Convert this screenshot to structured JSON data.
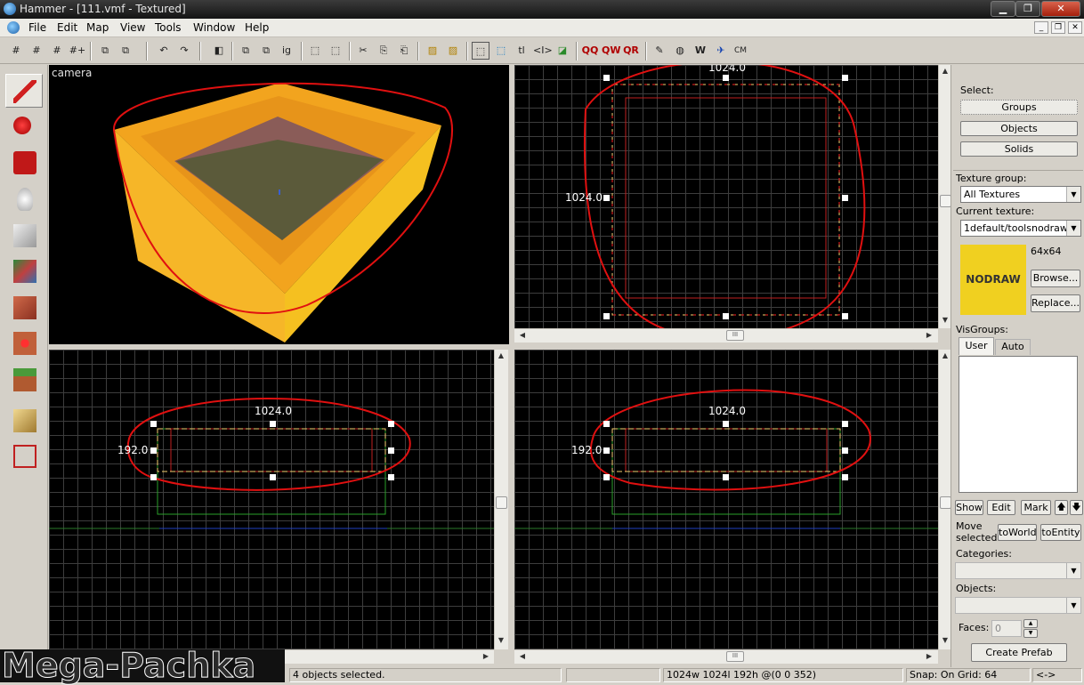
{
  "window": {
    "title": "Hammer - [111.vmf - Textured]",
    "min": "▁",
    "max": "❐",
    "close": "✕"
  },
  "menu": [
    "File",
    "Edit",
    "Map",
    "View",
    "Tools",
    "Window",
    "Help"
  ],
  "mdi": {
    "min": "_",
    "restore": "❐",
    "close": "✕"
  },
  "toolbar": {
    "items": [
      "#",
      "#",
      "#",
      "#+",
      "⧉",
      "⧉",
      "↶",
      "↷",
      "◧",
      "⧉",
      "⧉",
      "ig",
      "⬚",
      "⬚",
      "✂",
      "⎘",
      "⎗",
      "▨",
      "▨",
      "⬚",
      "⬚",
      "tl",
      "<I>",
      "◪",
      "QQ",
      "QW",
      "QR",
      "✎",
      "◍",
      "W",
      "✈",
      "CM"
    ]
  },
  "viewports": {
    "camera": {
      "label": "camera"
    },
    "top": {
      "width_label": "1024.0",
      "height_label": "1024.0"
    },
    "front": {
      "width_label": "1024.0",
      "height_label": "192.0"
    },
    "side": {
      "width_label": "1024.0",
      "height_label": "192.0"
    }
  },
  "right_panel": {
    "select_label": "Select:",
    "groups": "Groups",
    "objects": "Objects",
    "solids": "Solids",
    "texture_group_label": "Texture group:",
    "texture_group_value": "All Textures",
    "current_texture_label": "Current texture:",
    "current_texture_value": "1default/toolsnodraw",
    "texture_size": "64x64",
    "texture_preview_text": "NODRAW",
    "browse": "Browse...",
    "replace": "Replace...",
    "visgroups_label": "VisGroups:",
    "tab_user": "User",
    "tab_auto": "Auto",
    "show": "Show",
    "edit": "Edit",
    "mark": "Mark",
    "up": "🡅",
    "down": "🡇",
    "move_selected": "Move selected:",
    "to_world": "toWorld",
    "to_entity": "toEntity",
    "categories_label": "Categories:",
    "objects_label": "Objects:",
    "faces_label": "Faces:",
    "faces_value": "0",
    "create_prefab": "Create Prefab"
  },
  "status": {
    "selection": "4 objects selected.",
    "size": "1024w 1024l 192h @(0 0 352)",
    "snap": "Snap: On Grid: 64",
    "arrows": "<->"
  },
  "watermark": "Mega-Pachka",
  "colors": {
    "selection": "#ff2020",
    "annotation": "#e01010",
    "brush": "#f0a020",
    "grid": "#3d3d3d"
  }
}
